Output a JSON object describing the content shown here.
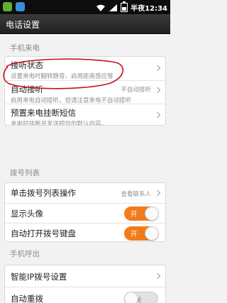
{
  "status_bar": {
    "time": "半夜12:34"
  },
  "title_bar": {
    "title": "电话设置"
  },
  "sections": {
    "incoming": "手机来电",
    "dial_list": "拨号列表",
    "outgoing": "手机呼出"
  },
  "incoming_rows": {
    "answer_state": {
      "label": "接听状态",
      "subtitle": "设置来电时翻转静音、启用距离感应等"
    },
    "auto_answer": {
      "label": "自动接听",
      "value": "不自动接听",
      "subtitle": "启用来电自动接听，但请注意来电不自动接听"
    },
    "sms_reject": {
      "label": "预置来电挂断短信",
      "subtitle": "来电时挂断并发送短信的默认内容。"
    }
  },
  "dial_rows": {
    "single_tap": {
      "label": "单击拨号列表操作",
      "value": "查看联系人"
    },
    "show_avatar": {
      "label": "显示头像",
      "toggle": "开"
    },
    "auto_keypad": {
      "label": "自动打开拨号键盘",
      "toggle": "开"
    }
  },
  "outgoing_rows": {
    "ip_dial": {
      "label": "智能IP拨号设置"
    },
    "auto_redial": {
      "label": "自动重拨",
      "toggle": "关"
    }
  },
  "colors": {
    "toggle_on": "#f27c1c",
    "annotation": "#c4121a",
    "title_bar": "#2b2b2b"
  }
}
